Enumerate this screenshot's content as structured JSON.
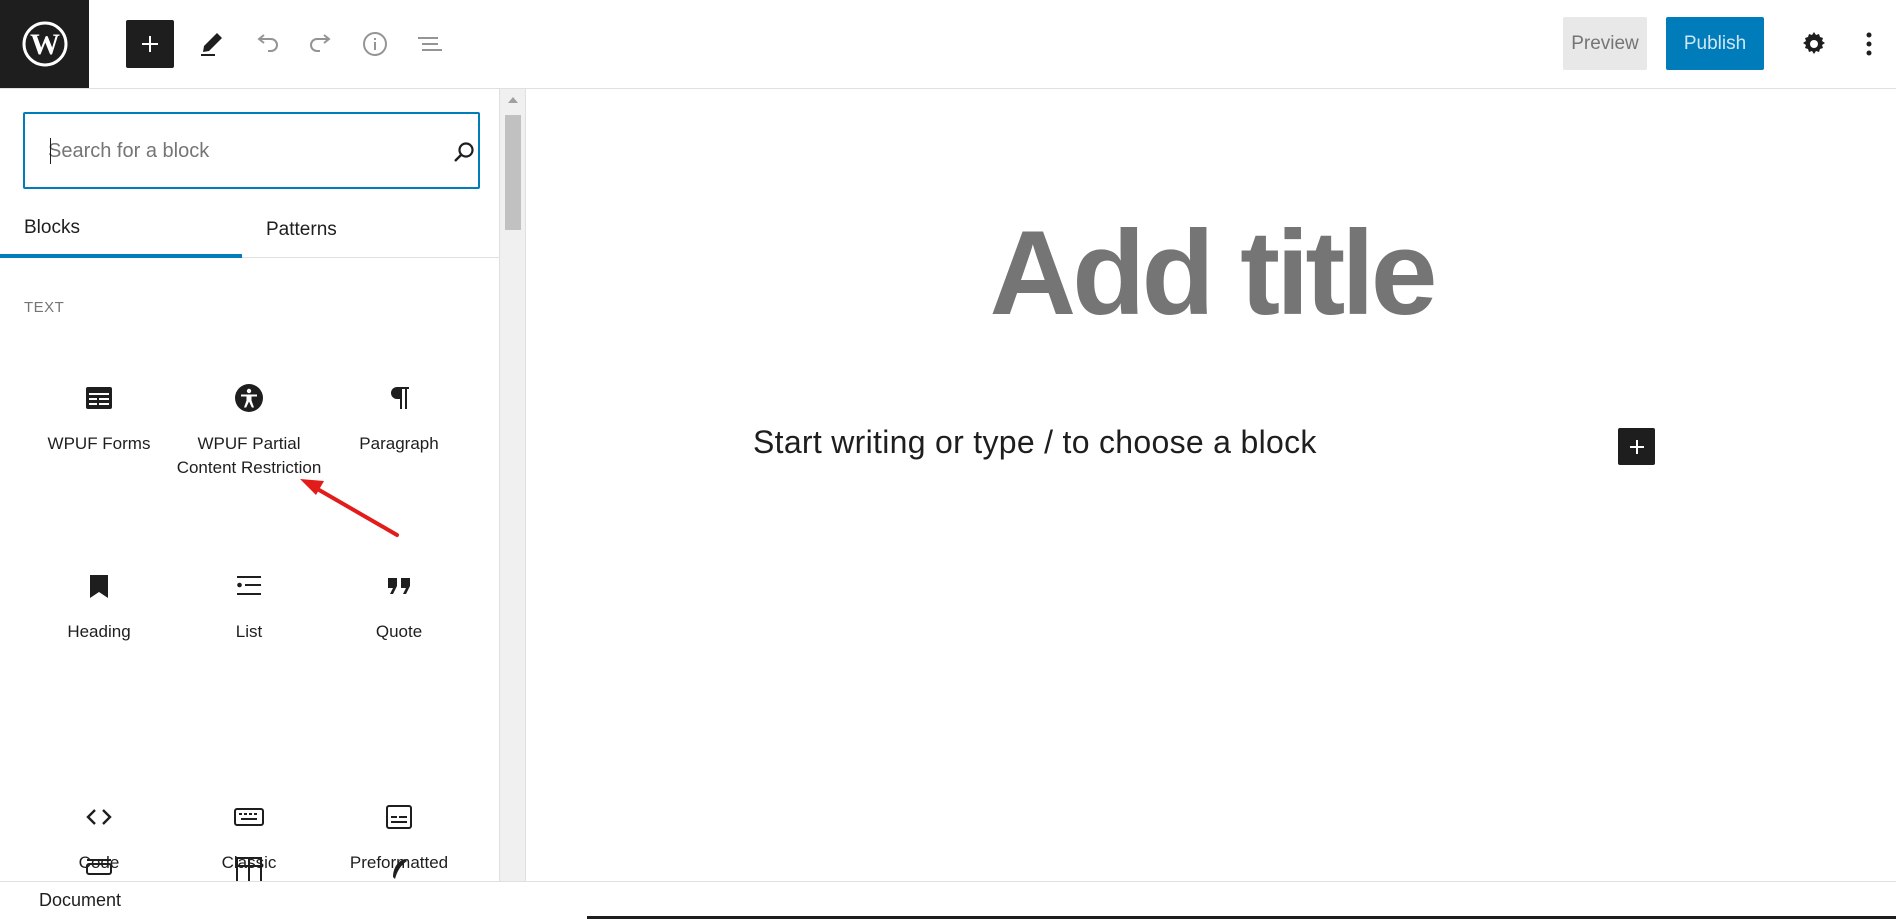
{
  "toolbar": {
    "preview_label": "Preview",
    "publish_label": "Publish",
    "colors": {
      "publish_bg": "#007cba",
      "dark": "#1e1e1e"
    }
  },
  "inserter": {
    "search": {
      "placeholder": "Search for a block",
      "value": ""
    },
    "tabs": [
      {
        "label": "Blocks",
        "active": true
      },
      {
        "label": "Patterns",
        "active": false
      }
    ],
    "section_title": "TEXT",
    "blocks": [
      {
        "label": "WPUF Forms",
        "icon": "wpuf-forms-icon"
      },
      {
        "label": "WPUF Partial Content Restriction",
        "icon": "accessibility-icon"
      },
      {
        "label": "Paragraph",
        "icon": "paragraph-icon"
      },
      {
        "label": "Heading",
        "icon": "bookmark-icon"
      },
      {
        "label": "List",
        "icon": "list-icon"
      },
      {
        "label": "Quote",
        "icon": "quote-icon"
      },
      {
        "label": "Code",
        "icon": "code-icon"
      },
      {
        "label": "Classic",
        "icon": "keyboard-icon"
      },
      {
        "label": "Preformatted",
        "icon": "preformatted-icon"
      }
    ]
  },
  "editor": {
    "title_placeholder": "Add title",
    "paragraph_placeholder": "Start writing or type / to choose a block"
  },
  "footer": {
    "label": "Document"
  }
}
